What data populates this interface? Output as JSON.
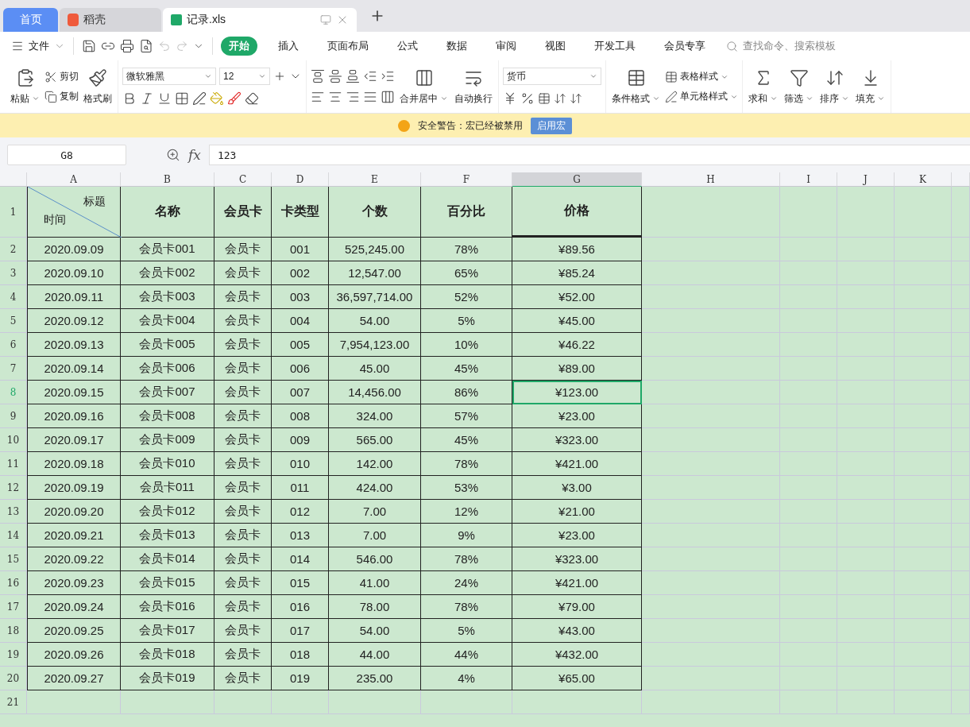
{
  "tabs": [
    {
      "label": "首页",
      "selected": false,
      "kind": "home"
    },
    {
      "label": "稻壳",
      "selected": false,
      "kind": "app"
    },
    {
      "label": "记录.xls",
      "selected": true,
      "kind": "file"
    }
  ],
  "menu": {
    "file": "文件",
    "tabs": [
      {
        "label": "开始",
        "selected": true
      },
      {
        "label": "插入",
        "selected": false
      },
      {
        "label": "页面布局",
        "selected": false
      },
      {
        "label": "公式",
        "selected": false
      },
      {
        "label": "数据",
        "selected": false
      },
      {
        "label": "审阅",
        "selected": false
      },
      {
        "label": "视图",
        "selected": false
      },
      {
        "label": "开发工具",
        "selected": false
      },
      {
        "label": "会员专享",
        "selected": false
      }
    ],
    "search": {
      "placeholder": "查找命令、搜索模板"
    }
  },
  "ribbon": {
    "paste": "粘贴",
    "cut": "剪切",
    "copy": "复制",
    "format_painter": "格式刷",
    "font_name": "微软雅黑",
    "font_size": "12",
    "merge": "合并居中",
    "wrap": "自动换行",
    "number_format": "货币",
    "conditional_format": "条件格式",
    "table_style": "表格样式",
    "cell_style": "单元格样式",
    "sum": "求和",
    "filter": "筛选",
    "sort": "排序",
    "fill": "填充"
  },
  "warning": {
    "text": "安全警告：宏已经被禁用",
    "button": "启用宏"
  },
  "formula_bar": {
    "cell_ref": "G8",
    "fx_label": "fx",
    "value": "123"
  },
  "sheet": {
    "columns": [
      {
        "label": "A",
        "selected": false
      },
      {
        "label": "B",
        "selected": false
      },
      {
        "label": "C",
        "selected": false
      },
      {
        "label": "D",
        "selected": false
      },
      {
        "label": "E",
        "selected": false
      },
      {
        "label": "F",
        "selected": false
      },
      {
        "label": "G",
        "selected": true
      },
      {
        "label": "H",
        "selected": false
      },
      {
        "label": "I",
        "selected": false
      },
      {
        "label": "J",
        "selected": false
      },
      {
        "label": "K",
        "selected": false
      }
    ],
    "header": {
      "number": "1",
      "diagonal_top": "标题",
      "diagonal_bottom": "时间",
      "cells": [
        "名称",
        "会员卡",
        "卡类型",
        "个数",
        "百分比",
        "价格"
      ]
    },
    "rows": [
      {
        "number": "2",
        "selected": false,
        "cells": [
          "2020.09.09",
          "会员卡001",
          "会员卡",
          "001",
          "525,245.00",
          "78%",
          "¥89.56"
        ]
      },
      {
        "number": "3",
        "selected": false,
        "cells": [
          "2020.09.10",
          "会员卡002",
          "会员卡",
          "002",
          "12,547.00",
          "65%",
          "¥85.24"
        ]
      },
      {
        "number": "4",
        "selected": false,
        "cells": [
          "2020.09.11",
          "会员卡003",
          "会员卡",
          "003",
          "36,597,714.00",
          "52%",
          "¥52.00"
        ]
      },
      {
        "number": "5",
        "selected": false,
        "cells": [
          "2020.09.12",
          "会员卡004",
          "会员卡",
          "004",
          "54.00",
          "5%",
          "¥45.00"
        ]
      },
      {
        "number": "6",
        "selected": false,
        "cells": [
          "2020.09.13",
          "会员卡005",
          "会员卡",
          "005",
          "7,954,123.00",
          "10%",
          "¥46.22"
        ]
      },
      {
        "number": "7",
        "selected": false,
        "cells": [
          "2020.09.14",
          "会员卡006",
          "会员卡",
          "006",
          "45.00",
          "45%",
          "¥89.00"
        ]
      },
      {
        "number": "8",
        "selected": true,
        "cells": [
          "2020.09.15",
          "会员卡007",
          "会员卡",
          "007",
          "14,456.00",
          "86%",
          "¥123.00"
        ]
      },
      {
        "number": "9",
        "selected": false,
        "cells": [
          "2020.09.16",
          "会员卡008",
          "会员卡",
          "008",
          "324.00",
          "57%",
          "¥23.00"
        ]
      },
      {
        "number": "10",
        "selected": false,
        "cells": [
          "2020.09.17",
          "会员卡009",
          "会员卡",
          "009",
          "565.00",
          "45%",
          "¥323.00"
        ]
      },
      {
        "number": "11",
        "selected": false,
        "cells": [
          "2020.09.18",
          "会员卡010",
          "会员卡",
          "010",
          "142.00",
          "78%",
          "¥421.00"
        ]
      },
      {
        "number": "12",
        "selected": false,
        "cells": [
          "2020.09.19",
          "会员卡011",
          "会员卡",
          "011",
          "424.00",
          "53%",
          "¥3.00"
        ]
      },
      {
        "number": "13",
        "selected": false,
        "cells": [
          "2020.09.20",
          "会员卡012",
          "会员卡",
          "012",
          "7.00",
          "12%",
          "¥21.00"
        ]
      },
      {
        "number": "14",
        "selected": false,
        "cells": [
          "2020.09.21",
          "会员卡013",
          "会员卡",
          "013",
          "7.00",
          "9%",
          "¥23.00"
        ]
      },
      {
        "number": "15",
        "selected": false,
        "cells": [
          "2020.09.22",
          "会员卡014",
          "会员卡",
          "014",
          "546.00",
          "78%",
          "¥323.00"
        ]
      },
      {
        "number": "16",
        "selected": false,
        "cells": [
          "2020.09.23",
          "会员卡015",
          "会员卡",
          "015",
          "41.00",
          "24%",
          "¥421.00"
        ]
      },
      {
        "number": "17",
        "selected": false,
        "cells": [
          "2020.09.24",
          "会员卡016",
          "会员卡",
          "016",
          "78.00",
          "78%",
          "¥79.00"
        ]
      },
      {
        "number": "18",
        "selected": false,
        "cells": [
          "2020.09.25",
          "会员卡017",
          "会员卡",
          "017",
          "54.00",
          "5%",
          "¥43.00"
        ]
      },
      {
        "number": "19",
        "selected": false,
        "cells": [
          "2020.09.26",
          "会员卡018",
          "会员卡",
          "018",
          "44.00",
          "44%",
          "¥432.00"
        ]
      },
      {
        "number": "20",
        "selected": false,
        "cells": [
          "2020.09.27",
          "会员卡019",
          "会员卡",
          "019",
          "235.00",
          "4%",
          "¥65.00"
        ]
      }
    ],
    "empty_rows": [
      {
        "number": "21"
      }
    ]
  }
}
